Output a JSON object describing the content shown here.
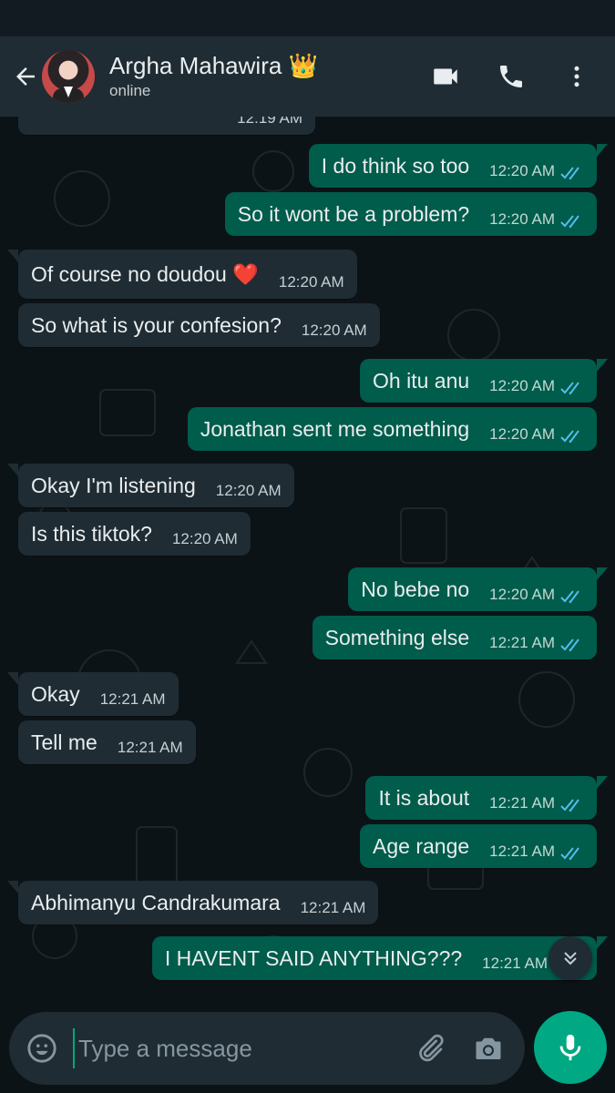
{
  "contact": {
    "name": "Argha Mahawira 👑",
    "status": "online"
  },
  "colors": {
    "header_bg": "#1f2c33",
    "incoming_bubble": "#1f2c33",
    "outgoing_bubble": "#005c4b",
    "accent": "#00a884",
    "read_tick": "#53bdeb"
  },
  "icons": {
    "back": "arrow-left-icon",
    "video": "video-call-icon",
    "voice": "phone-icon",
    "menu": "more-vertical-icon",
    "emoji": "emoji-icon",
    "attach": "paperclip-icon",
    "camera": "camera-icon",
    "mic": "microphone-icon",
    "scroll": "chevron-down-icon"
  },
  "messages": [
    {
      "dir": "in",
      "text": "",
      "time": "12:19 AM",
      "partial": true
    },
    {
      "dir": "out",
      "text": "I do think so too",
      "time": "12:20 AM",
      "status": "read"
    },
    {
      "dir": "out",
      "text": "So it wont be a problem?",
      "time": "12:20 AM",
      "status": "read"
    },
    {
      "dir": "in",
      "text": "Of course no doudou ❤️",
      "time": "12:20 AM"
    },
    {
      "dir": "in",
      "text": "So what is your confesion?",
      "time": "12:20 AM"
    },
    {
      "dir": "out",
      "text": "Oh itu anu",
      "time": "12:20 AM",
      "status": "read"
    },
    {
      "dir": "out",
      "text": "Jonathan sent me something",
      "time": "12:20 AM",
      "status": "read"
    },
    {
      "dir": "in",
      "text": "Okay I'm listening",
      "time": "12:20 AM"
    },
    {
      "dir": "in",
      "text": "Is this tiktok?",
      "time": "12:20 AM"
    },
    {
      "dir": "out",
      "text": "No bebe no",
      "time": "12:20 AM",
      "status": "read"
    },
    {
      "dir": "out",
      "text": "Something else",
      "time": "12:21 AM",
      "status": "read"
    },
    {
      "dir": "in",
      "text": "Okay",
      "time": "12:21 AM"
    },
    {
      "dir": "in",
      "text": "Tell me",
      "time": "12:21 AM"
    },
    {
      "dir": "out",
      "text": "It is about",
      "time": "12:21 AM",
      "status": "read"
    },
    {
      "dir": "out",
      "text": "Age range",
      "time": "12:21 AM",
      "status": "read"
    },
    {
      "dir": "in",
      "text": "Abhimanyu Candrakumara",
      "time": "12:21 AM"
    },
    {
      "dir": "out",
      "text": "I HAVENT SAID ANYTHING???",
      "time": "12:21 AM",
      "status": "read"
    }
  ],
  "composer": {
    "placeholder": "Type a message"
  }
}
